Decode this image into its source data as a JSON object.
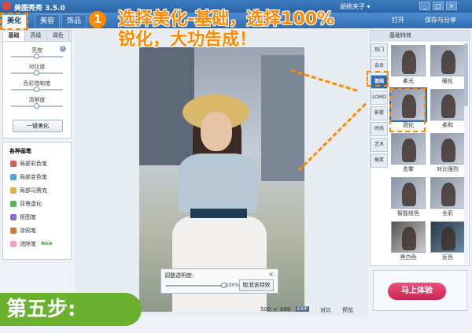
{
  "window": {
    "title": "美图秀秀 3.5.0",
    "user": "胡桃夹子 ▾",
    "buttons": [
      "_",
      "□",
      "×"
    ]
  },
  "tabs": [
    {
      "label": "美化",
      "active": true
    },
    {
      "label": "美容",
      "active": false
    },
    {
      "label": "饰品",
      "active": false
    }
  ],
  "toolbar": {
    "open_label": "打开",
    "save_share_label": "保存与分享"
  },
  "left_panel": {
    "subtabs": [
      "基础",
      "高级",
      "调色"
    ],
    "sliders": [
      {
        "label": "亮度",
        "value": 0.5
      },
      {
        "label": "对比度",
        "value": 0.5
      },
      {
        "label": "色彩饱和度",
        "value": 0.5
      },
      {
        "label": "清晰度",
        "value": 0.5
      }
    ],
    "onekey_label": "一键美化"
  },
  "brush_panel": {
    "title": "各种画笔",
    "items": [
      "局部彩色笔",
      "局部变色笔",
      "局部马赛克",
      "背景虚化",
      "抠图笔",
      "涂鸦笔",
      "消除笔"
    ],
    "new_badge": "New"
  },
  "opacity_panel": {
    "label": "调整透明度:",
    "value_text": "100%",
    "value": 1.0,
    "cancel_label": "取消该特效"
  },
  "statusbar": {
    "width": "500",
    "sep": "×",
    "height": "666",
    "exif": "EXIF",
    "compare": "对比",
    "preview": "预览"
  },
  "right_panel": {
    "header": "基础特效",
    "categories": [
      "热门",
      "会员",
      "基础",
      "LOMO",
      "影楼",
      "时尚",
      "艺术",
      "搞笑"
    ],
    "active_category": "基础",
    "effects": [
      "柔光",
      "暖化",
      "锐化",
      "柔和",
      "去雾",
      "对比强烈",
      "智能绘色",
      "全彩",
      "黑白色",
      "反色"
    ],
    "selected_effect": "锐化"
  },
  "ad": {
    "button_label": "马上体验"
  },
  "annotation": {
    "step_number": "1",
    "callout_line1": "选择美化-基础，选择100%",
    "callout_line2": "锐化，大功告成！",
    "step_banner": "第五步:",
    "color": "#ff8a00"
  }
}
